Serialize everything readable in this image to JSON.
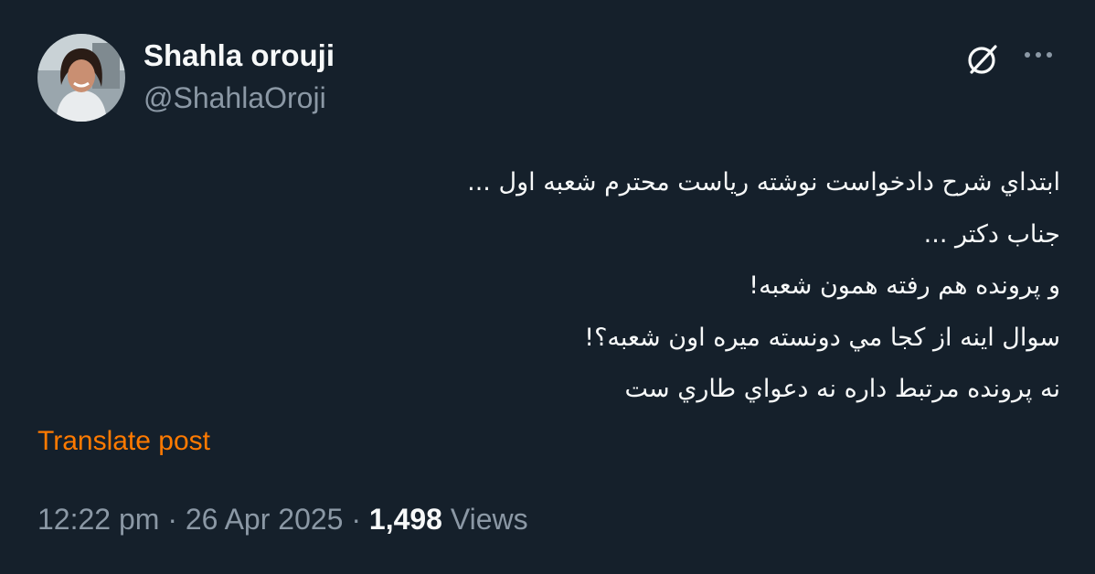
{
  "author": {
    "display_name": "Shahla orouji",
    "handle": "@ShahlaOroji"
  },
  "icons": {
    "grok": "grok-icon",
    "more": "more-icon"
  },
  "post": {
    "lines": [
      "ابتداي شرح دادخواست نوشته رياست محترم شعبه اول ...",
      "جناب دكتر ...",
      "و پرونده هم رفته همون شعبه!",
      "سوال اينه از كجا مي دونسته ميره اون شعبه؟!",
      "نه پرونده مرتبط داره نه دعواي طاري ست"
    ],
    "translate_label": "Translate post"
  },
  "meta": {
    "time": "12:22 pm",
    "separator": "·",
    "date": "26 Apr 2025",
    "views_count": "1,498",
    "views_label": "Views"
  },
  "colors": {
    "background": "#15202b",
    "primary_text": "#f7f9f9",
    "secondary_text": "#8b98a5",
    "link": "#ff7a00"
  }
}
